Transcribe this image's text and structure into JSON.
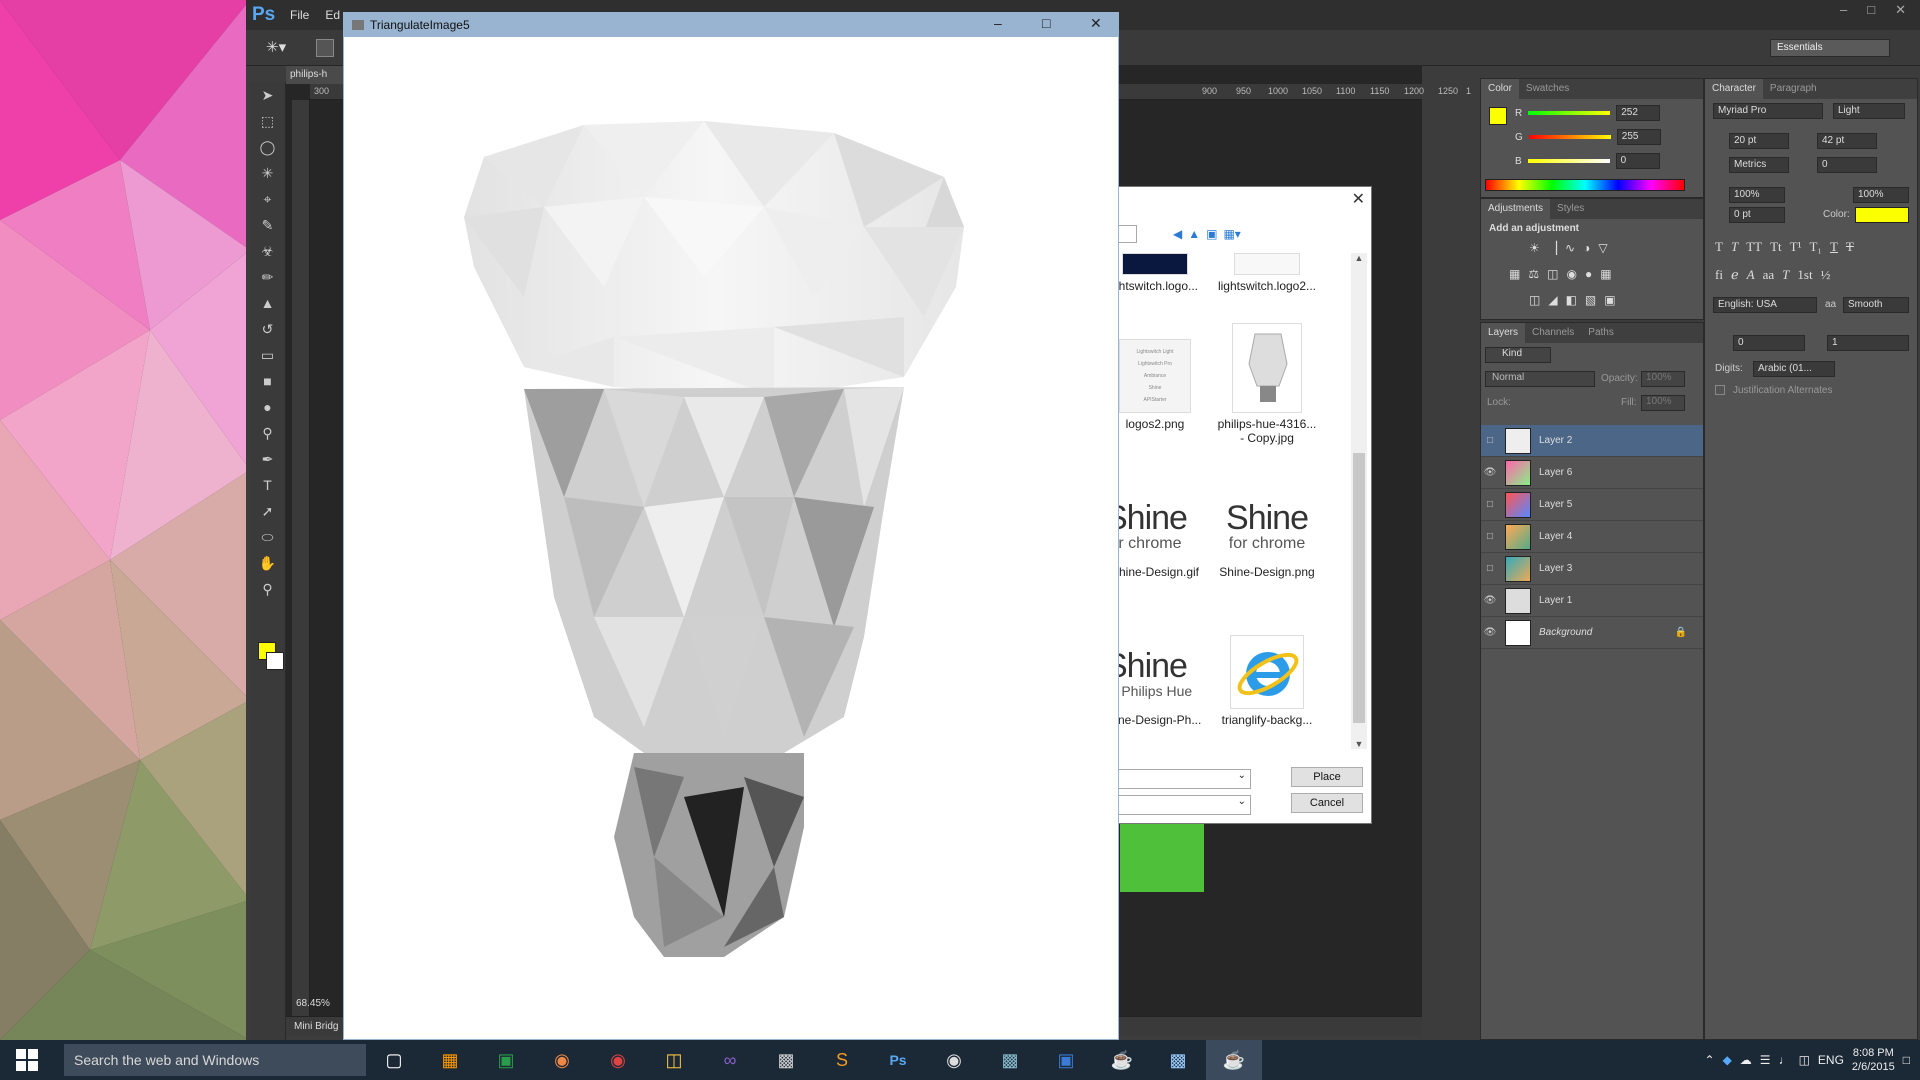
{
  "ps": {
    "logo": "Ps",
    "menu": [
      "File",
      "Ed"
    ],
    "workspace": "Essentials",
    "doc_tab": "philips-h",
    "zoom": "68.45%",
    "mini_bridge": "Mini Bridg",
    "ruler_top": [
      "300",
      "900",
      "950",
      "1000",
      "1050",
      "1100",
      "1150",
      "1200",
      "1250",
      "1"
    ],
    "colors": {
      "foreground": "#fcff00",
      "background": "#ffffff"
    }
  },
  "color_panel": {
    "tabs": [
      "Color",
      "Swatches"
    ],
    "r_label": "R",
    "g_label": "G",
    "b_label": "B",
    "r": "252",
    "g": "255",
    "b": "0"
  },
  "adjustments_panel": {
    "tabs": [
      "Adjustments",
      "Styles"
    ],
    "heading": "Add an adjustment"
  },
  "layers_panel": {
    "tabs": [
      "Layers",
      "Channels",
      "Paths"
    ],
    "kind": "Kind",
    "blend_mode": "Normal",
    "opacity_label": "Opacity:",
    "opacity": "100%",
    "lock_label": "Lock:",
    "fill_label": "Fill:",
    "fill": "100%",
    "layers": [
      {
        "name": "Layer 2",
        "visible": false,
        "selected": true
      },
      {
        "name": "Layer 6",
        "visible": true,
        "selected": false
      },
      {
        "name": "Layer 5",
        "visible": false,
        "selected": false
      },
      {
        "name": "Layer 4",
        "visible": false,
        "selected": false
      },
      {
        "name": "Layer 3",
        "visible": false,
        "selected": false
      },
      {
        "name": "Layer 1",
        "visible": true,
        "selected": false
      },
      {
        "name": "Background",
        "visible": true,
        "selected": false
      }
    ]
  },
  "character_panel": {
    "tabs": [
      "Character",
      "Paragraph"
    ],
    "font_family": "Myriad Pro",
    "font_style": "Light",
    "size": "20 pt",
    "leading": "42 pt",
    "kerning": "Metrics",
    "tracking": "0",
    "vscale": "100%",
    "hscale": "100%",
    "baseline": "0 pt",
    "color_label": "Color:",
    "language": "English: USA",
    "aa_label": "aa",
    "antialias": "Smooth",
    "field_a": "0",
    "field_b": "1",
    "digits_label": "Digits:",
    "digits": "Arabic (01...",
    "justification": "Justification Alternates"
  },
  "file_dialog": {
    "files": [
      {
        "name": "ghtswitch.logo..."
      },
      {
        "name": "lightswitch.logo2..."
      },
      {
        "name": "logos2.png",
        "lines": [
          "Lightswitch Light",
          "Lightswitch Pro",
          "Ambiance",
          "Shine",
          "APIStarter"
        ]
      },
      {
        "name": "philips-hue-4316...",
        "name2": "- Copy.jpg"
      },
      {
        "name": "Shine-Design.gif",
        "brand": "Shine",
        "sub": "for chrome"
      },
      {
        "name": "Shine-Design.png",
        "brand": "Shine",
        "sub": "for chrome"
      },
      {
        "name": "hine-Design-Ph...",
        "brand": "Shine",
        "sub": "or Philips Hue"
      },
      {
        "name": "trianglify-backg..."
      }
    ],
    "place": "Place",
    "cancel": "Cancel"
  },
  "tri_window": {
    "title": "TriangulateImage5"
  },
  "taskbar": {
    "search": "Search the web and Windows",
    "lang": "ENG",
    "time": "8:08 PM",
    "date": "2/6/2015"
  }
}
